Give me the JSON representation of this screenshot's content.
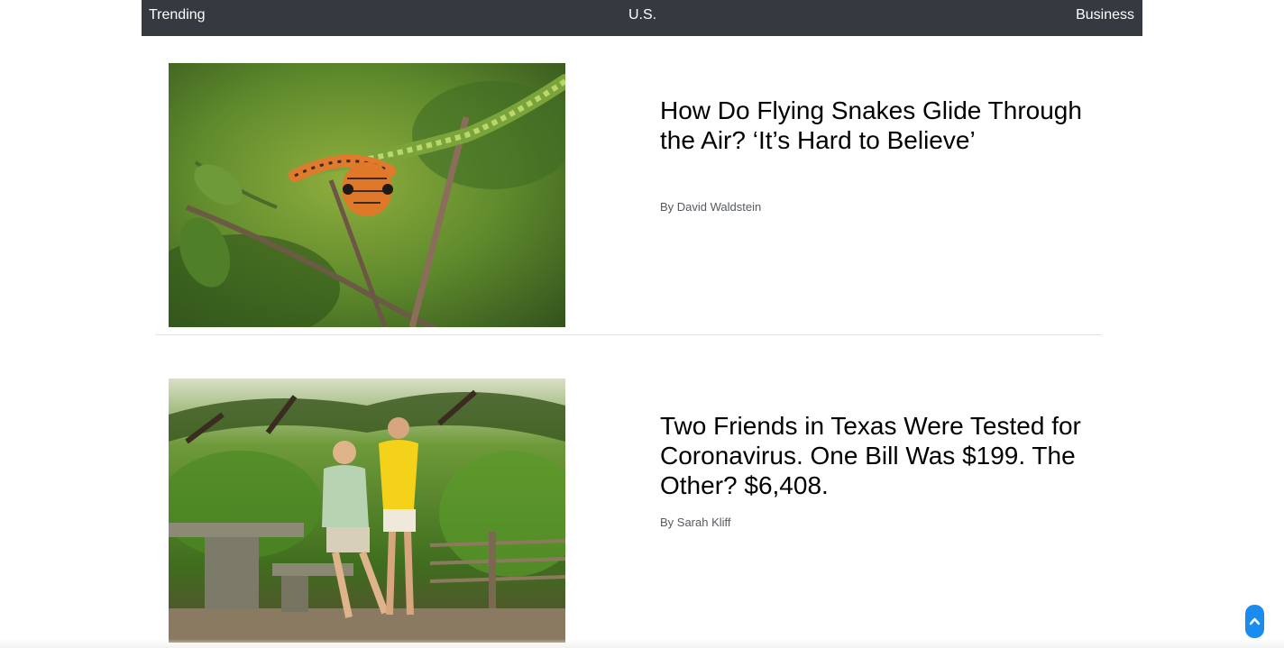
{
  "nav": {
    "items": [
      {
        "label": "Trending"
      },
      {
        "label": "U.S."
      },
      {
        "label": "Business"
      }
    ]
  },
  "articles": [
    {
      "headline": "How Do Flying Snakes Glide Through the Air? ‘It’s Hard to Believe’",
      "byline": "By David Waldstein",
      "image_icon": "flying-snake-photo"
    },
    {
      "headline": "Two Friends in Texas Were Tested for Coronavirus. One Bill Was $199. The Other? $6,408.",
      "byline": "By Sarah Kliff",
      "image_icon": "two-friends-park-photo"
    }
  ],
  "scroll_top": {
    "icon": "chevron-up-icon"
  },
  "colors": {
    "navbar_bg": "#343a40",
    "accent": "#1a8cf0",
    "byline": "#555b61"
  }
}
